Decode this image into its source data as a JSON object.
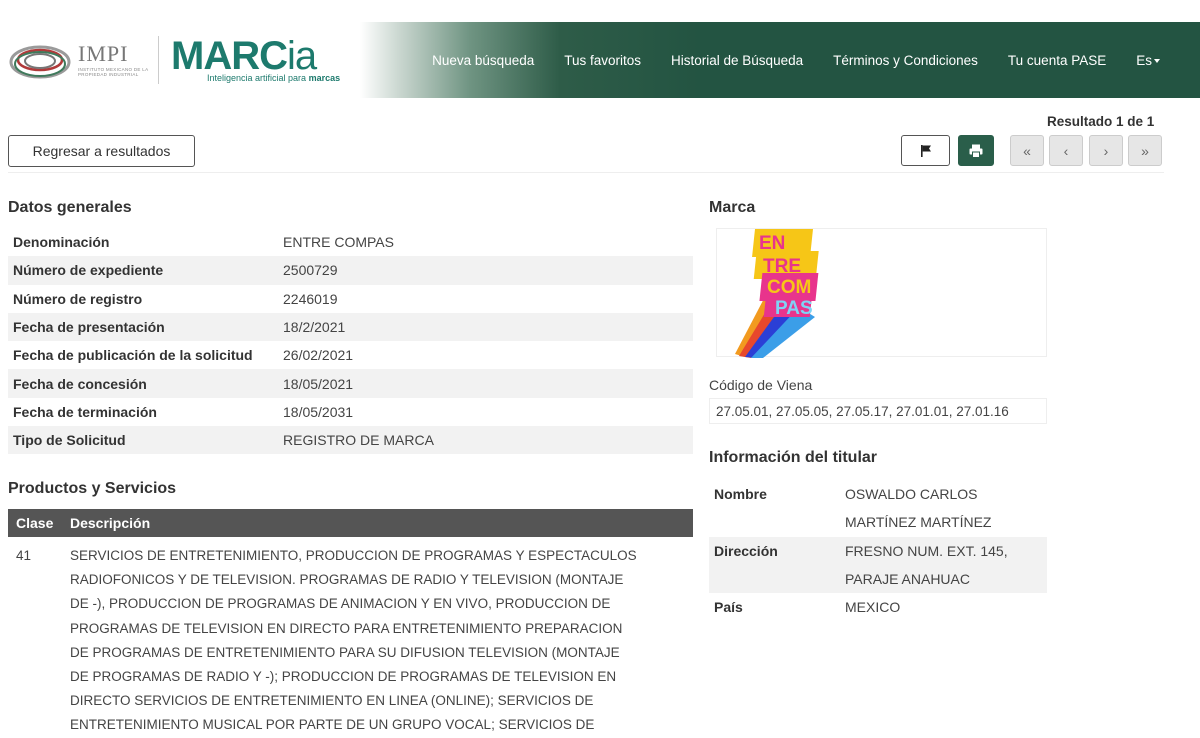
{
  "header": {
    "impi": {
      "title": "IMPI",
      "subtitle": "INSTITUTO MEXICANO DE LA PROPIEDAD INDUSTRIAL"
    },
    "marcia": {
      "logo_main": "MARC",
      "logo_suffix": "ia",
      "tagline_prefix": "Inteligencia artificial para ",
      "tagline_bold": "marcas"
    },
    "nav": [
      {
        "label": "Nueva búsqueda"
      },
      {
        "label": "Tus favoritos"
      },
      {
        "label": "Historial de Búsqueda"
      },
      {
        "label": "Términos y Condiciones"
      },
      {
        "label": "Tu cuenta PASE"
      },
      {
        "label": "Es"
      }
    ],
    "bg_color": "#235442"
  },
  "toolbar": {
    "result_count": "Resultado 1 de 1",
    "back_label": "Regresar a resultados",
    "pagination": [
      "«",
      "‹",
      "›",
      "»"
    ],
    "flag_icon": "flag-icon",
    "print_icon": "print-icon"
  },
  "datos_generales": {
    "title": "Datos generales",
    "rows": [
      {
        "key": "Denominación",
        "value": "ENTRE COMPAS"
      },
      {
        "key": "Número de expediente",
        "value": "2500729"
      },
      {
        "key": "Número de registro",
        "value": "2246019"
      },
      {
        "key": "Fecha de presentación",
        "value": "18/2/2021"
      },
      {
        "key": "Fecha de publicación de la solicitud",
        "value": "26/02/2021"
      },
      {
        "key": "Fecha de concesión",
        "value": "18/05/2021"
      },
      {
        "key": "Fecha de terminación",
        "value": "18/05/2031"
      },
      {
        "key": "Tipo de Solicitud",
        "value": "REGISTRO DE MARCA"
      }
    ]
  },
  "productos": {
    "title": "Productos y Servicios",
    "col_clase": "Clase",
    "col_desc": "Descripción",
    "rows": [
      {
        "clase": "41",
        "lines": [
          "SERVICIOS DE ENTRETENIMIENTO, PRODUCCION DE PROGRAMAS Y ESPECTACULOS",
          "RADIOFONICOS Y DE TELEVISION. PROGRAMAS DE RADIO Y TELEVISION (MONTAJE",
          "DE -), PRODUCCION DE PROGRAMAS DE ANIMACION Y EN VIVO, PRODUCCION DE",
          "PROGRAMAS DE TELEVISION EN DIRECTO PARA ENTRETENIMIENTO PREPARACION",
          "DE PROGRAMAS DE ENTRETENIMIENTO PARA SU DIFUSION TELEVISION (MONTAJE",
          "DE PROGRAMAS DE RADIO Y -); PRODUCCION DE PROGRAMAS DE TELEVISION EN",
          "DIRECTO SERVICIOS DE ENTRETENIMIENTO EN LINEA (ONLINE); SERVICIOS DE",
          "ENTRETENIMIENTO MUSICAL POR PARTE DE UN GRUPO VOCAL; SERVICIOS DE"
        ]
      }
    ]
  },
  "marca": {
    "title": "Marca",
    "logo_letters": [
      "EN",
      "TRE",
      "COM",
      "PAS"
    ],
    "viena_label": "Código de Viena",
    "viena_value": "27.05.01, 27.05.05, 27.05.17, 27.01.01, 27.01.16"
  },
  "titular": {
    "title": "Información del titular",
    "rows": [
      {
        "key": "Nombre",
        "lines": [
          "OSWALDO CARLOS",
          "MARTÍNEZ MARTÍNEZ"
        ]
      },
      {
        "key": "Dirección",
        "lines": [
          "FRESNO NUM. EXT. 145,",
          "PARAJE ANAHUAC"
        ]
      },
      {
        "key": "País",
        "lines": [
          "MEXICO"
        ]
      }
    ]
  }
}
